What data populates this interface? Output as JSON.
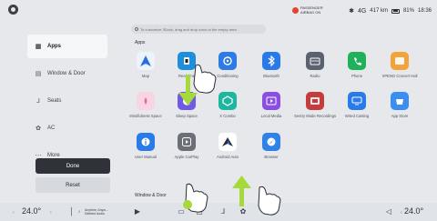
{
  "status": {
    "hint": "To customize 3Dock, drag and drop icons to the empty area",
    "airbag": "PASSENGER AIRBAG ON",
    "range": "417 km",
    "battery": "81%",
    "signal": "4G",
    "time": "18:36"
  },
  "sidebar": {
    "items": [
      {
        "label": "Apps",
        "icon": "apps-grid-icon"
      },
      {
        "label": "Window & Door",
        "icon": "car-door-icon"
      },
      {
        "label": "Seats",
        "icon": "seat-icon"
      },
      {
        "label": "AC",
        "icon": "fan-icon"
      },
      {
        "label": "More",
        "icon": "more-icon"
      }
    ],
    "done_label": "Done",
    "reset_label": "Reset"
  },
  "apps": {
    "section_title": "Apps",
    "items": [
      {
        "label": "Map",
        "color": "#2a6fe0"
      },
      {
        "label": "Real-time",
        "color": "#1f8fdc"
      },
      {
        "label": "Conditioning",
        "color": "#2e7be6"
      },
      {
        "label": "Bluetooth",
        "color": "#2979e8"
      },
      {
        "label": "Radio",
        "color": "#5a6270"
      },
      {
        "label": "Phone",
        "color": "#20b25a"
      },
      {
        "label": "XPENG Concert Hall",
        "color": "#f2a33a"
      },
      {
        "label": "Mindfulness Space",
        "color": "#f3a7c4"
      },
      {
        "label": "Sleep Space",
        "color": "#6f5ae6"
      },
      {
        "label": "X Combo",
        "color": "#1fb6a0"
      },
      {
        "label": "Local Media",
        "color": "#8a4ee3"
      },
      {
        "label": "Sentry Mode Recordings",
        "color": "#c63b3b"
      },
      {
        "label": "Wired Casting",
        "color": "#2a7be8"
      },
      {
        "label": "App Store",
        "color": "#3a8ef2"
      },
      {
        "label": "User Manual",
        "color": "#2a7be8"
      },
      {
        "label": "Apple CarPlay",
        "color": "#6b6f77"
      },
      {
        "label": "Android Auto",
        "color": "#ffffff"
      },
      {
        "label": "Browser",
        "color": "#2f83e6"
      }
    ]
  },
  "window_door": {
    "section_title": "Window & Door"
  },
  "dock": {
    "left_temp": "24.0°",
    "right_temp": "24.0°",
    "music_line1": "Anytime, Anyw...",
    "music_line2": "Deleted Audio"
  }
}
